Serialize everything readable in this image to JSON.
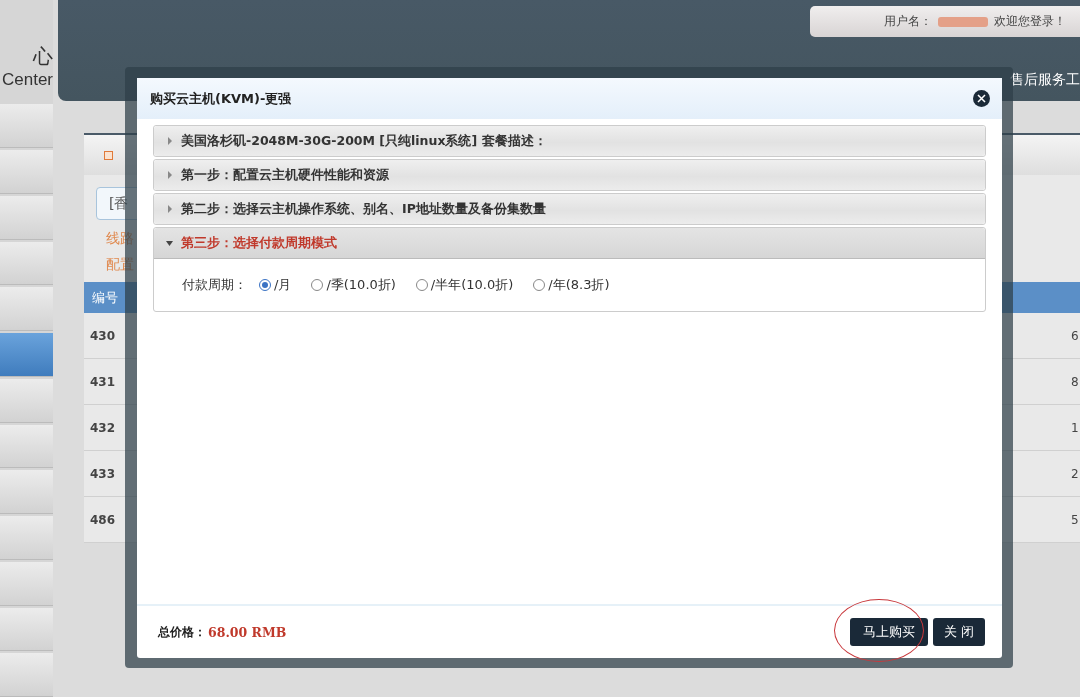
{
  "sidebar": {
    "brand": "心",
    "brand_sub": "Center",
    "items": [
      {
        "selected": false
      },
      {
        "selected": false
      },
      {
        "selected": false
      },
      {
        "selected": false
      },
      {
        "selected": false
      },
      {
        "selected": true
      },
      {
        "selected": false
      },
      {
        "selected": false
      },
      {
        "selected": false
      },
      {
        "selected": false
      },
      {
        "selected": false
      },
      {
        "selected": false
      },
      {
        "selected": false
      }
    ]
  },
  "header": {
    "user_label": "用户名：",
    "welcome": "欢迎您登录！",
    "nav_item": "售后服务工"
  },
  "panel": {
    "filter_button": "[香",
    "links": [
      "线路",
      "配置"
    ],
    "columns": [
      "编号"
    ],
    "rows": [
      {
        "id": "430",
        "column_last": "6"
      },
      {
        "id": "431",
        "column_last": "8"
      },
      {
        "id": "432",
        "column_last": "1"
      },
      {
        "id": "433",
        "column_last": "2"
      },
      {
        "id": "486",
        "column_last": "5"
      }
    ]
  },
  "dialog": {
    "title": "购买云主机(KVM)-更强",
    "sections": [
      {
        "title": "美国洛杉矶-2048M-30G-200M [只纯linux系统] 套餐描述：",
        "expanded": false
      },
      {
        "title": "第一步：配置云主机硬件性能和资源",
        "expanded": false
      },
      {
        "title": "第二步：选择云主机操作系统、别名、IP地址数量及备份集数量",
        "expanded": false
      },
      {
        "title": "第三步：选择付款周期模式",
        "expanded": true
      }
    ],
    "payment_label": "付款周期：",
    "options": [
      {
        "label": "/月",
        "selected": true
      },
      {
        "label": "/季(10.0折)",
        "selected": false
      },
      {
        "label": "/半年(10.0折)",
        "selected": false
      },
      {
        "label": "/年(8.3折)",
        "selected": false
      }
    ],
    "total_label": "总价格：",
    "total_value": "68.00 RMB",
    "buttons": [
      {
        "label": "马上购买",
        "kind": "buy",
        "circled": true
      },
      {
        "label": "关 闭",
        "kind": "close",
        "circled": false
      }
    ]
  }
}
